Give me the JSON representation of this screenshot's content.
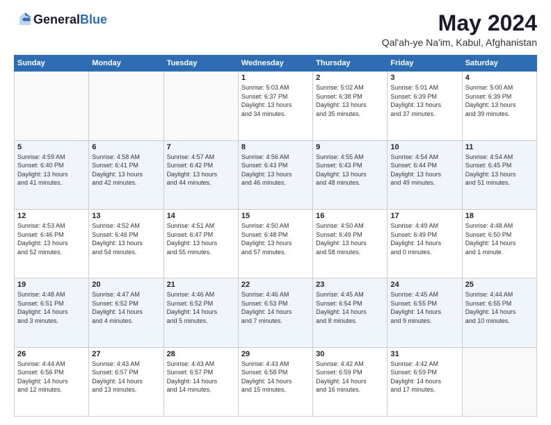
{
  "logo": {
    "general": "General",
    "blue": "Blue"
  },
  "header": {
    "month": "May 2024",
    "location": "Qal'ah-ye Na'im, Kabul, Afghanistan"
  },
  "weekdays": [
    "Sunday",
    "Monday",
    "Tuesday",
    "Wednesday",
    "Thursday",
    "Friday",
    "Saturday"
  ],
  "weeks": [
    [
      {
        "day": "",
        "info": ""
      },
      {
        "day": "",
        "info": ""
      },
      {
        "day": "",
        "info": ""
      },
      {
        "day": "1",
        "info": "Sunrise: 5:03 AM\nSunset: 6:37 PM\nDaylight: 13 hours\nand 34 minutes."
      },
      {
        "day": "2",
        "info": "Sunrise: 5:02 AM\nSunset: 6:38 PM\nDaylight: 13 hours\nand 35 minutes."
      },
      {
        "day": "3",
        "info": "Sunrise: 5:01 AM\nSunset: 6:39 PM\nDaylight: 13 hours\nand 37 minutes."
      },
      {
        "day": "4",
        "info": "Sunrise: 5:00 AM\nSunset: 6:39 PM\nDaylight: 13 hours\nand 39 minutes."
      }
    ],
    [
      {
        "day": "5",
        "info": "Sunrise: 4:59 AM\nSunset: 6:40 PM\nDaylight: 13 hours\nand 41 minutes."
      },
      {
        "day": "6",
        "info": "Sunrise: 4:58 AM\nSunset: 6:41 PM\nDaylight: 13 hours\nand 42 minutes."
      },
      {
        "day": "7",
        "info": "Sunrise: 4:57 AM\nSunset: 6:42 PM\nDaylight: 13 hours\nand 44 minutes."
      },
      {
        "day": "8",
        "info": "Sunrise: 4:56 AM\nSunset: 6:43 PM\nDaylight: 13 hours\nand 46 minutes."
      },
      {
        "day": "9",
        "info": "Sunrise: 4:55 AM\nSunset: 6:43 PM\nDaylight: 13 hours\nand 48 minutes."
      },
      {
        "day": "10",
        "info": "Sunrise: 4:54 AM\nSunset: 6:44 PM\nDaylight: 13 hours\nand 49 minutes."
      },
      {
        "day": "11",
        "info": "Sunrise: 4:54 AM\nSunset: 6:45 PM\nDaylight: 13 hours\nand 51 minutes."
      }
    ],
    [
      {
        "day": "12",
        "info": "Sunrise: 4:53 AM\nSunset: 6:46 PM\nDaylight: 13 hours\nand 52 minutes."
      },
      {
        "day": "13",
        "info": "Sunrise: 4:52 AM\nSunset: 6:46 PM\nDaylight: 13 hours\nand 54 minutes."
      },
      {
        "day": "14",
        "info": "Sunrise: 4:51 AM\nSunset: 6:47 PM\nDaylight: 13 hours\nand 55 minutes."
      },
      {
        "day": "15",
        "info": "Sunrise: 4:50 AM\nSunset: 6:48 PM\nDaylight: 13 hours\nand 57 minutes."
      },
      {
        "day": "16",
        "info": "Sunrise: 4:50 AM\nSunset: 6:49 PM\nDaylight: 13 hours\nand 58 minutes."
      },
      {
        "day": "17",
        "info": "Sunrise: 4:49 AM\nSunset: 6:49 PM\nDaylight: 14 hours\nand 0 minutes."
      },
      {
        "day": "18",
        "info": "Sunrise: 4:48 AM\nSunset: 6:50 PM\nDaylight: 14 hours\nand 1 minute."
      }
    ],
    [
      {
        "day": "19",
        "info": "Sunrise: 4:48 AM\nSunset: 6:51 PM\nDaylight: 14 hours\nand 3 minutes."
      },
      {
        "day": "20",
        "info": "Sunrise: 4:47 AM\nSunset: 6:52 PM\nDaylight: 14 hours\nand 4 minutes."
      },
      {
        "day": "21",
        "info": "Sunrise: 4:46 AM\nSunset: 6:52 PM\nDaylight: 14 hours\nand 5 minutes."
      },
      {
        "day": "22",
        "info": "Sunrise: 4:46 AM\nSunset: 6:53 PM\nDaylight: 14 hours\nand 7 minutes."
      },
      {
        "day": "23",
        "info": "Sunrise: 4:45 AM\nSunset: 6:54 PM\nDaylight: 14 hours\nand 8 minutes."
      },
      {
        "day": "24",
        "info": "Sunrise: 4:45 AM\nSunset: 6:55 PM\nDaylight: 14 hours\nand 9 minutes."
      },
      {
        "day": "25",
        "info": "Sunrise: 4:44 AM\nSunset: 6:55 PM\nDaylight: 14 hours\nand 10 minutes."
      }
    ],
    [
      {
        "day": "26",
        "info": "Sunrise: 4:44 AM\nSunset: 6:56 PM\nDaylight: 14 hours\nand 12 minutes."
      },
      {
        "day": "27",
        "info": "Sunrise: 4:43 AM\nSunset: 6:57 PM\nDaylight: 14 hours\nand 13 minutes."
      },
      {
        "day": "28",
        "info": "Sunrise: 4:43 AM\nSunset: 6:57 PM\nDaylight: 14 hours\nand 14 minutes."
      },
      {
        "day": "29",
        "info": "Sunrise: 4:43 AM\nSunset: 6:58 PM\nDaylight: 14 hours\nand 15 minutes."
      },
      {
        "day": "30",
        "info": "Sunrise: 4:42 AM\nSunset: 6:59 PM\nDaylight: 14 hours\nand 16 minutes."
      },
      {
        "day": "31",
        "info": "Sunrise: 4:42 AM\nSunset: 6:59 PM\nDaylight: 14 hours\nand 17 minutes."
      },
      {
        "day": "",
        "info": ""
      }
    ]
  ]
}
